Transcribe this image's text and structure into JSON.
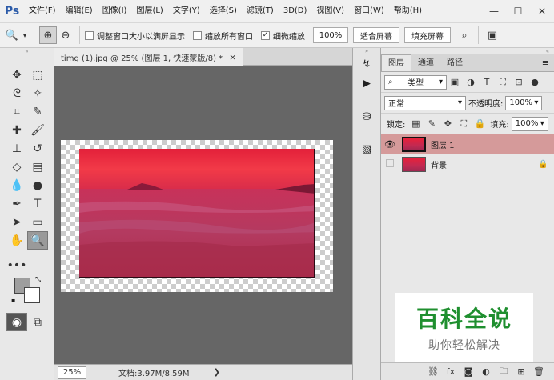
{
  "app": {
    "logo": "Ps"
  },
  "menu": [
    "文件(F)",
    "编辑(E)",
    "图像(I)",
    "图层(L)",
    "文字(Y)",
    "选择(S)",
    "滤镜(T)",
    "3D(D)",
    "视图(V)",
    "窗口(W)",
    "帮助(H)"
  ],
  "window_controls": {
    "minimize": "—",
    "maximize": "☐",
    "close": "✕"
  },
  "options": {
    "resize_windows_label": "调整窗口大小以满屏显示",
    "zoom_all_label": "缩放所有窗口",
    "scrubby_zoom_label": "细微缩放",
    "zoom_100": "100%",
    "fit_screen": "适合屏幕",
    "fill_screen": "填充屏幕"
  },
  "document": {
    "tab_title": "timg (1).jpg @ 25% (图层 1, 快速蒙版/8) *",
    "tab_close": "×"
  },
  "status": {
    "zoom": "25%",
    "doc_info": "文档:3.97M/8.59M",
    "arrow": "❯"
  },
  "layers_panel": {
    "tabs": [
      "图层",
      "通道",
      "路径"
    ],
    "filter_kind": "类型",
    "blend_mode": "正常",
    "opacity_label": "不透明度:",
    "opacity_value": "100%",
    "lock_label": "锁定:",
    "fill_label": "填充:",
    "fill_value": "100%",
    "layers": [
      {
        "name": "图层 1",
        "visible": true,
        "selected": true
      },
      {
        "name": "背景",
        "visible": false,
        "selected": false,
        "locked": true
      }
    ]
  },
  "watermark": {
    "title": "百科全说",
    "subtitle": "助你轻松解决"
  }
}
